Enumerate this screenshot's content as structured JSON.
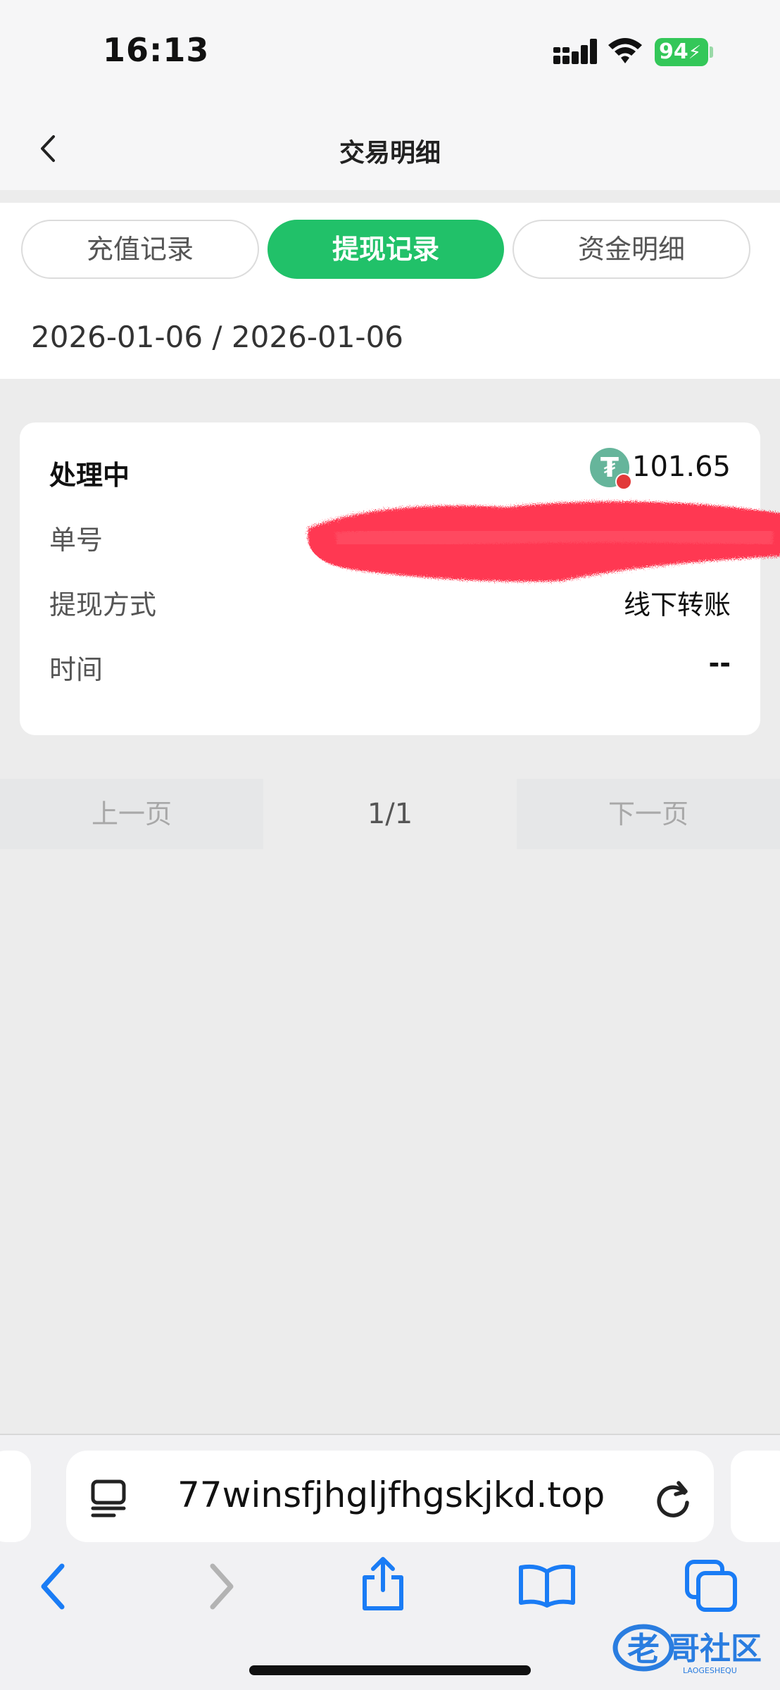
{
  "status_bar": {
    "time": "16:13",
    "battery": "94"
  },
  "header": {
    "title": "交易明细"
  },
  "tabs": [
    {
      "label": "充值记录",
      "active": false
    },
    {
      "label": "提现记录",
      "active": true
    },
    {
      "label": "资金明细",
      "active": false
    }
  ],
  "filter": {
    "date_range": "2026-01-06 / 2026-01-06"
  },
  "record": {
    "status": "处理中",
    "amount": "101.65",
    "coin_icon": "tether-usdt-icon",
    "order_label": "单号",
    "method_label": "提现方式",
    "method_value": "线下转账",
    "time_label": "时间",
    "time_value": "--"
  },
  "pagination": {
    "prev_label": "上一页",
    "page": "1/1",
    "next_label": "下一页"
  },
  "browser": {
    "url": "77winsfjhgljfhgskjkd.top"
  },
  "watermark": {
    "text": "老哥社区",
    "subtext": "LAOGESHEQU"
  },
  "colors": {
    "accent": "#21c169",
    "background": "#ececec",
    "redaction": "#ff2d48"
  }
}
